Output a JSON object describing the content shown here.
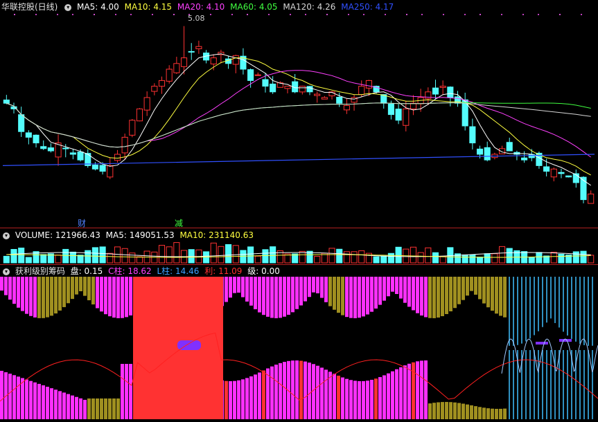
{
  "main": {
    "title": "华联控股(日线)",
    "ma": [
      {
        "label": "MA5: 4.00",
        "color": "#ffffff"
      },
      {
        "label": "MA10: 4.15",
        "color": "#ffff40"
      },
      {
        "label": "MA20: 4.10",
        "color": "#ff40ff"
      },
      {
        "label": "MA60: 4.05",
        "color": "#40ff40"
      },
      {
        "label": "MA120: 4.26",
        "color": "#d8d8d8"
      },
      {
        "label": "MA250: 4.17",
        "color": "#3050ff"
      }
    ],
    "high_label": "5.08",
    "marker_cai": "财",
    "marker_jian": "减"
  },
  "volume_panel": {
    "labels": [
      {
        "label": "VOLUME: 121966.43",
        "color": "#ffffff"
      },
      {
        "label": "MA5: 149051.53",
        "color": "#ffffff"
      },
      {
        "label": "MA10: 231140.63",
        "color": "#ffff40"
      }
    ]
  },
  "indicator_panel": {
    "title": "获利级别筹码",
    "labels": [
      {
        "label": "盘: 0.15",
        "color": "#ffffff"
      },
      {
        "label": "C柱: 18.62",
        "color": "#ff40ff"
      },
      {
        "label": "L柱: 14.46",
        "color": "#40a0ff"
      },
      {
        "label": "利: 11.09",
        "color": "#ff3030"
      },
      {
        "label": "级: 0.00",
        "color": "#ffffff"
      }
    ]
  },
  "colors": {
    "up": "#ff3232",
    "down": "#54fcfc",
    "magenta": "#ff30ff",
    "olive": "#a09020",
    "blue_bar": "#3090c0",
    "purple": "#8030ff",
    "separator": "#b02020"
  },
  "chart_data": {
    "type": "candlestick",
    "title": "华联控股(日线)",
    "series": [
      {
        "name": "MA5",
        "last": 4.0
      },
      {
        "name": "MA10",
        "last": 4.15
      },
      {
        "name": "MA20",
        "last": 4.1
      },
      {
        "name": "MA60",
        "last": 4.05
      },
      {
        "name": "MA120",
        "last": 4.26
      },
      {
        "name": "MA250",
        "last": 4.17
      }
    ],
    "close": [
      4.4,
      4.35,
      4.15,
      4.1,
      4.05,
      4.0,
      3.98,
      4.05,
      4.0,
      3.95,
      3.9,
      3.85,
      3.82,
      3.8,
      3.85,
      3.95,
      4.1,
      4.25,
      4.35,
      4.45,
      4.55,
      4.6,
      4.7,
      4.75,
      4.8,
      4.85,
      4.9,
      4.78,
      4.8,
      4.85,
      4.75,
      4.82,
      4.7,
      4.6,
      4.65,
      4.55,
      4.5,
      4.58,
      4.55,
      4.5,
      4.55,
      4.5,
      4.48,
      4.45,
      4.5,
      4.4,
      4.38,
      4.45,
      4.55,
      4.6,
      4.5,
      4.4,
      4.3,
      4.25,
      4.35,
      4.4,
      4.45,
      4.5,
      4.48,
      4.55,
      4.45,
      4.4,
      4.2,
      4.05,
      3.95,
      3.9,
      3.95,
      4.0,
      3.98,
      3.95,
      3.9,
      3.92,
      3.85,
      3.8,
      3.82,
      3.78,
      3.75,
      3.7,
      3.55,
      3.6
    ],
    "high_marker": 5.08,
    "volume": {
      "last": 121966.43,
      "ma5": 149051.53,
      "ma10": 231140.63
    },
    "indicator": {
      "盘": 0.15,
      "C柱": 18.62,
      "L柱": 14.46,
      "利": 11.09,
      "级": 0.0
    }
  }
}
